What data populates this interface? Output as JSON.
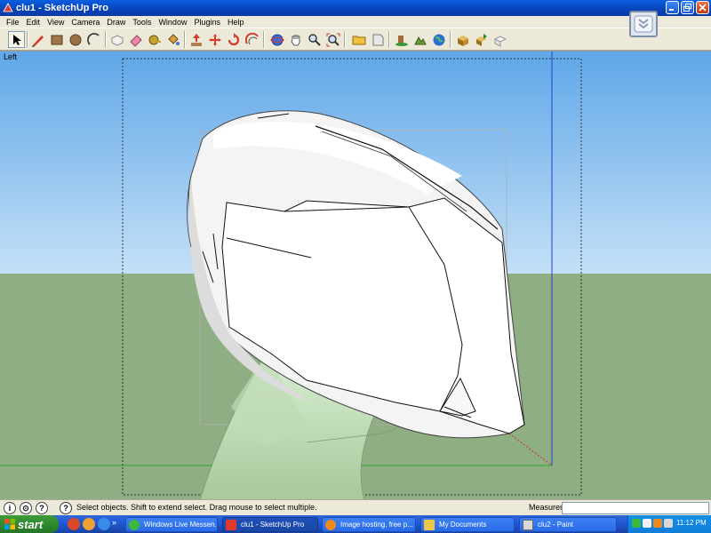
{
  "window": {
    "title": "clu1 - SketchUp Pro"
  },
  "menu": [
    "File",
    "Edit",
    "View",
    "Camera",
    "Draw",
    "Tools",
    "Window",
    "Plugins",
    "Help"
  ],
  "viewport": {
    "view_label": "Left"
  },
  "status": {
    "message": "Select objects. Shift to extend select. Drag mouse to select multiple.",
    "measurements_label": "Measurements",
    "measurements_value": ""
  },
  "taskbar": {
    "start_label": "start",
    "overflow": "»",
    "tasks": [
      {
        "label": "Windows Live Messen...",
        "icon": "messenger-icon"
      },
      {
        "label": "clu1 - SketchUp Pro",
        "icon": "sketchup-icon"
      },
      {
        "label": "Image hosting, free p...",
        "icon": "firefox-icon"
      },
      {
        "label": "My Documents",
        "icon": "folder-icon"
      },
      {
        "label": "clu2 - Paint",
        "icon": "paint-icon"
      }
    ],
    "clock": "11:12 PM"
  },
  "colors": {
    "sky_top": "#5fa7e8",
    "sky_bottom": "#c4e0f7",
    "ground": "#8fae83",
    "green_axis": "#2fa52f",
    "blue_axis": "#1f3fd8",
    "red_axis": "#c83030"
  }
}
